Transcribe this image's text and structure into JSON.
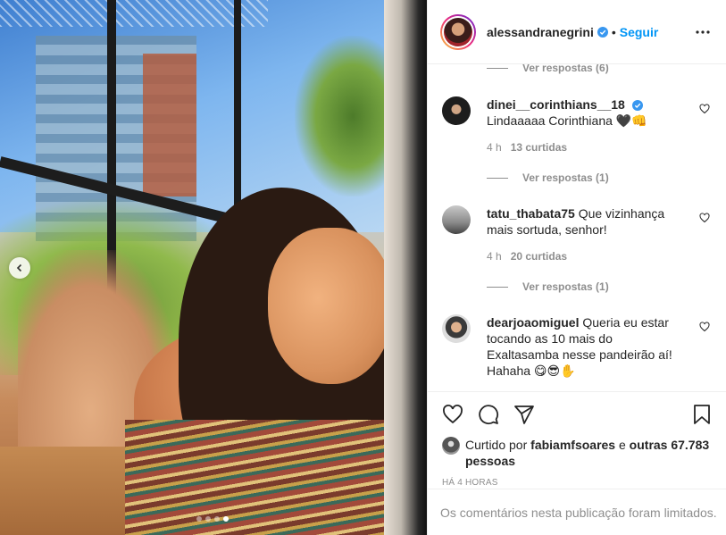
{
  "post": {
    "author": "alessandranegrini",
    "separator": "•",
    "follow_label": "Seguir",
    "carousel": {
      "total": 4,
      "active_index": 3
    }
  },
  "comments": {
    "view_replies_top": "Ver respostas (6)",
    "items": [
      {
        "user": "dinei__corinthians__18",
        "verified": true,
        "text": "Lindaaaaa Corinthiana 🖤👊",
        "time": "4 h",
        "likes": "13 curtidas",
        "replies": "Ver respostas (1)"
      },
      {
        "user": "tatu_thabata75",
        "verified": false,
        "text": "Que vizinhança mais sortuda, senhor!",
        "time": "4 h",
        "likes": "20 curtidas",
        "replies": "Ver respostas (1)"
      },
      {
        "user": "dearjoaomiguel",
        "verified": false,
        "text": "Queria eu estar tocando as 10 mais do Exaltasamba nesse pandeirão aí! Hahaha 😋😎✋"
      }
    ]
  },
  "likes": {
    "prefix": "Curtido por",
    "user": "fabiamfsoares",
    "connector": "e",
    "others": "outras 67.783 pessoas"
  },
  "timestamp": "HÁ 4 HORAS",
  "comments_limited": "Os comentários nesta publicação foram limitados.",
  "colors": {
    "accent": "#0095f6",
    "muted": "#8e8e8e",
    "text": "#262626",
    "border": "#efefef"
  }
}
